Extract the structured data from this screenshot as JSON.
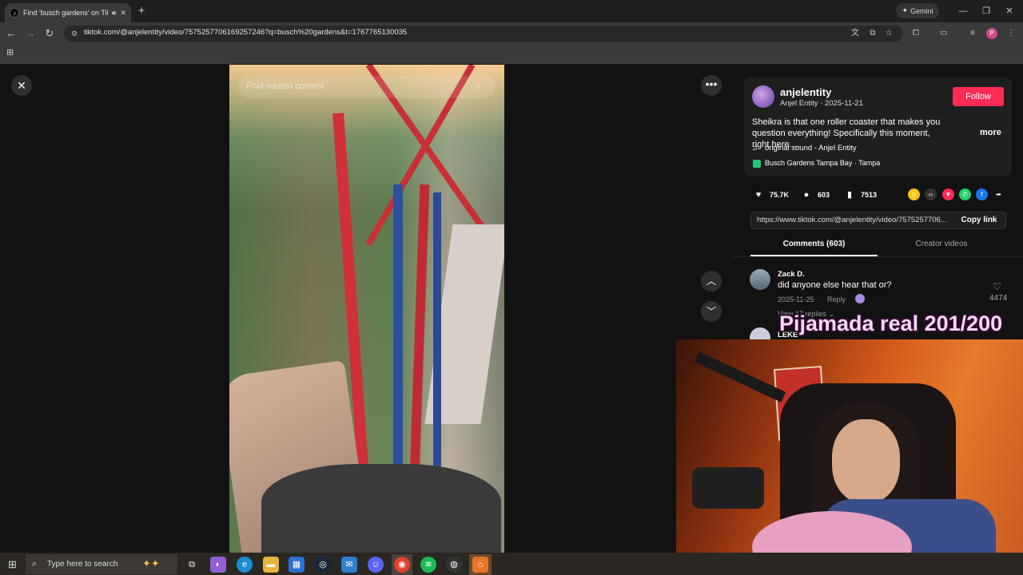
{
  "browser": {
    "tab_title": "Find 'busch gardens' on Tik",
    "new_tab": "+",
    "gemini_label": "Gemini",
    "url": "tiktok.com/@anjelentity/video/7575257706169257246?q=busch%20gardens&t=1767765130035",
    "profile_initial": "P",
    "window_controls": [
      "—",
      "❐",
      "✕"
    ]
  },
  "video": {
    "search_placeholder": "Find related content"
  },
  "post": {
    "username": "anjelentity",
    "subline": "Anjel Entity · 2025-11-21",
    "follow_label": "Follow",
    "caption": "Sheikra is that one roller coaster that makes you question everything! Specifically this moment, right here. ...",
    "more_label": "more",
    "music": "original sound - Anjel Entity",
    "location": "Busch Gardens Tampa Bay · Tampa",
    "likes": "75.7K",
    "comments_count": "603",
    "saves": "7513",
    "link": "https://www.tiktok.com/@anjelentity/video/7575257706...",
    "copy_link_label": "Copy link"
  },
  "tabs": {
    "comments": "Comments (603)",
    "creator": "Creator videos"
  },
  "comments": [
    {
      "name": "Zack D.",
      "text": "did anyone else hear that or?",
      "date": "2025-11-25",
      "reply": "Reply",
      "likes": "4474",
      "view_replies": "View 17 replies ⌄"
    },
    {
      "name": "LEKE"
    }
  ],
  "overlay_text": "Pijamada real 201/200",
  "taskbar": {
    "search_placeholder": "Type here to search"
  },
  "colors": {
    "follow": "#fe2c55",
    "background": "#121212"
  }
}
